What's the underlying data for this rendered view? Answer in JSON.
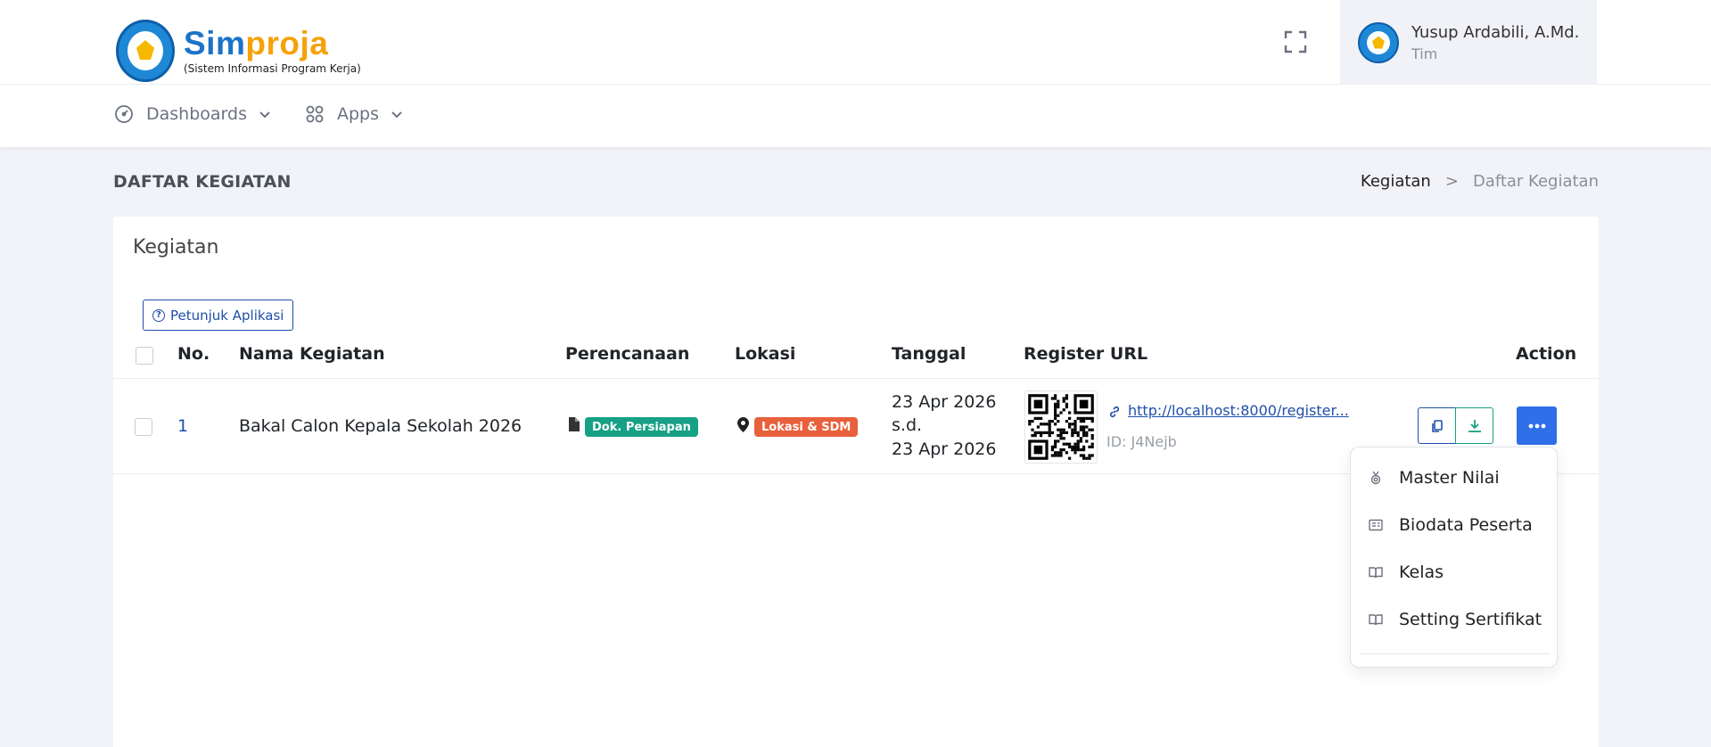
{
  "brand": {
    "title_part1": "Sim",
    "title_part2": "proja",
    "subtitle": "(Sistem Informasi Program Kerja)"
  },
  "user": {
    "name": "Yusup Ardabili, A.Md.",
    "role": "Tim"
  },
  "nav": {
    "items": [
      {
        "label": "Dashboards",
        "icon": "gauge-icon"
      },
      {
        "label": "Apps",
        "icon": "grid-icon"
      }
    ]
  },
  "page": {
    "title": "DAFTAR KEGIATAN",
    "breadcrumb": {
      "parent": "Kegiatan",
      "separator": ">",
      "current": "Daftar Kegiatan"
    }
  },
  "card": {
    "title": "Kegiatan",
    "help_button": "Petunjuk Aplikasi"
  },
  "table": {
    "headers": {
      "no": "No.",
      "nama": "Nama Kegiatan",
      "perencanaan": "Perencanaan",
      "lokasi": "Lokasi",
      "tanggal": "Tanggal",
      "register": "Register URL",
      "action": "Action"
    },
    "rows": [
      {
        "no": "1",
        "nama": "Bakal Calon Kepala Sekolah 2026",
        "perencanaan_badge": "Dok. Persiapan",
        "lokasi_badge": "Lokasi & SDM",
        "tanggal_start": "23 Apr 2026",
        "tanggal_sep": "s.d.",
        "tanggal_end": "23 Apr 2026",
        "register_url": "http://localhost:8000/register...",
        "register_id": "ID: J4Nejb"
      }
    ]
  },
  "dropdown": {
    "items": [
      {
        "label": "Master Nilai",
        "icon": "medal-icon"
      },
      {
        "label": "Biodata Peserta",
        "icon": "id-card-icon"
      },
      {
        "label": "Kelas",
        "icon": "book-icon"
      },
      {
        "label": "Setting Sertifikat",
        "icon": "book-icon"
      }
    ]
  },
  "colors": {
    "primary": "#2f6fe8",
    "badge_green": "#16a085",
    "badge_red": "#e8603c",
    "brand_blue": "#1a73c8",
    "brand_orange": "#f5a20a"
  }
}
